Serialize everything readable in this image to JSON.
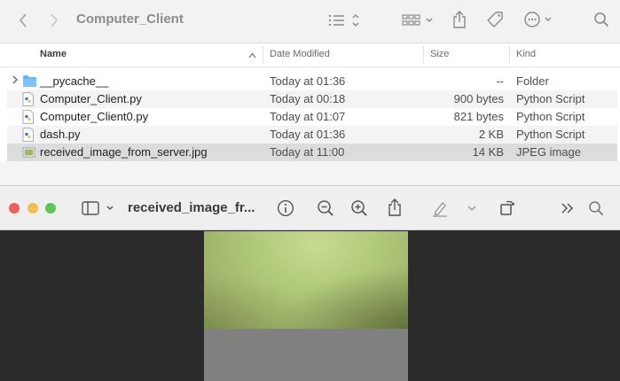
{
  "finder": {
    "title": "Computer_Client",
    "toolbar_icons": [
      "back-arrow-icon",
      "forward-arrow-icon",
      "list-view-icon",
      "gallery-group-icon",
      "share-icon",
      "tag-icon",
      "more-options-icon",
      "search-icon"
    ],
    "columns": {
      "name": "Name",
      "date": "Date Modified",
      "size": "Size",
      "kind": "Kind"
    },
    "files": [
      {
        "name": "__pycache__",
        "date": "Today at 01:36",
        "size": "--",
        "kind": "Folder",
        "icon": "folder-icon"
      },
      {
        "name": "Computer_Client.py",
        "date": "Today at 00:18",
        "size": "900 bytes",
        "kind": "Python Script",
        "icon": "python-file-icon"
      },
      {
        "name": "Computer_Client0.py",
        "date": "Today at 01:07",
        "size": "821 bytes",
        "kind": "Python Script",
        "icon": "python-file-icon"
      },
      {
        "name": "dash.py",
        "date": "Today at 01:36",
        "size": "2 KB",
        "kind": "Python Script",
        "icon": "python-file-icon"
      },
      {
        "name": "received_image_from_server.jpg",
        "date": "Today at 11:00",
        "size": "14 KB",
        "kind": "JPEG image",
        "icon": "jpeg-file-icon"
      }
    ]
  },
  "preview": {
    "title": "received_image_fr...",
    "colors": {
      "close": "#ee5f57",
      "minimize": "#f4bd4f",
      "zoom": "#5fc454",
      "photo": "#b5cc7e",
      "letterbox": "#808080"
    }
  }
}
